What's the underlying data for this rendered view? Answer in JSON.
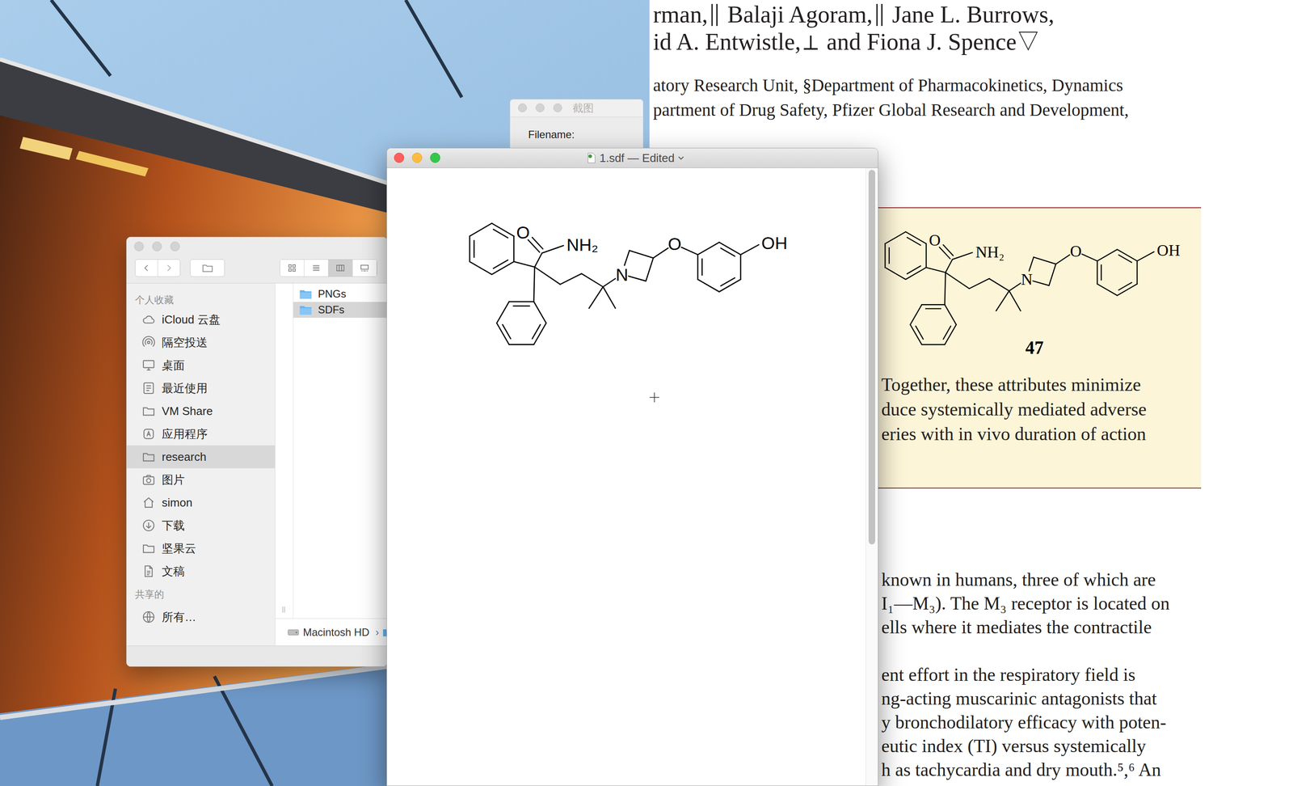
{
  "editor": {
    "title": "1.sdf — Edited",
    "active": true,
    "atoms": [
      "O",
      "NH₂",
      "N",
      "O",
      "OH"
    ],
    "scrollbar": {
      "level": 0.61
    }
  },
  "screenshot_window": {
    "title": "截图",
    "active": false,
    "filename_label": "Filename:"
  },
  "finder": {
    "active": false,
    "favorites_header": "个人收藏",
    "favorites": [
      {
        "label": "iCloud 云盘",
        "kind": "cloud",
        "selected": false
      },
      {
        "label": "隔空投送",
        "kind": "airdrop",
        "selected": false
      },
      {
        "label": "桌面",
        "kind": "desktop",
        "selected": false
      },
      {
        "label": "最近使用",
        "kind": "recent",
        "selected": false
      },
      {
        "label": "VM Share",
        "kind": "folder",
        "selected": false
      },
      {
        "label": "应用程序",
        "kind": "apps",
        "selected": false
      },
      {
        "label": "research",
        "kind": "folder",
        "selected": true
      },
      {
        "label": "图片",
        "kind": "pictures",
        "selected": false
      },
      {
        "label": "simon",
        "kind": "home",
        "selected": false
      },
      {
        "label": "下载",
        "kind": "downloads",
        "selected": false
      },
      {
        "label": "坚果云",
        "kind": "folder",
        "selected": false
      },
      {
        "label": "文稿",
        "kind": "documents",
        "selected": false
      }
    ],
    "shared_header": "共享的",
    "shared": [
      {
        "label": "所有…",
        "kind": "network",
        "selected": false
      }
    ],
    "view_modes": [
      {
        "kind": "icons",
        "selected": false
      },
      {
        "kind": "list",
        "selected": false
      },
      {
        "kind": "columns",
        "selected": true
      },
      {
        "kind": "gallery",
        "selected": false
      }
    ],
    "column_items": [
      {
        "label": "PNGs",
        "selected": false
      },
      {
        "label": "SDFs",
        "selected": true
      }
    ],
    "path": [
      "Macintosh HD"
    ],
    "path_separator": "›"
  },
  "pdf": {
    "author_lines": [
      "rman,∥ Balaji Agoram,∥ Jane L. Burrows,",
      "id A. Entwistle,⊥ and Fiona J. Spence▽"
    ],
    "affiliation_lines": [
      "atory Research Unit, §Department of Pharmacokinetics, Dynamics",
      "partment of Drug Safety, Pfizer Global Research and Development,"
    ],
    "figure": {
      "atoms": [
        "O",
        "NH₂",
        "N",
        "O",
        "OH"
      ],
      "compound_number": "47",
      "caption_lines": [
        "Together, these attributes minimize",
        "duce systemically mediated adverse",
        "eries with in vivo duration of action"
      ]
    },
    "paragraphs": [
      [
        "known in humans, three of which are",
        "I₁—M₃). The M₃ receptor is located on",
        "ells where it mediates the contractile"
      ],
      [
        "ent effort in the respiratory field is",
        "ng-acting muscarinic antagonists that",
        "y bronchodilatory efficacy with poten-",
        "eutic index (TI) versus systemically",
        "h as tachycardia and dry mouth.⁵,⁶ An"
      ]
    ]
  }
}
